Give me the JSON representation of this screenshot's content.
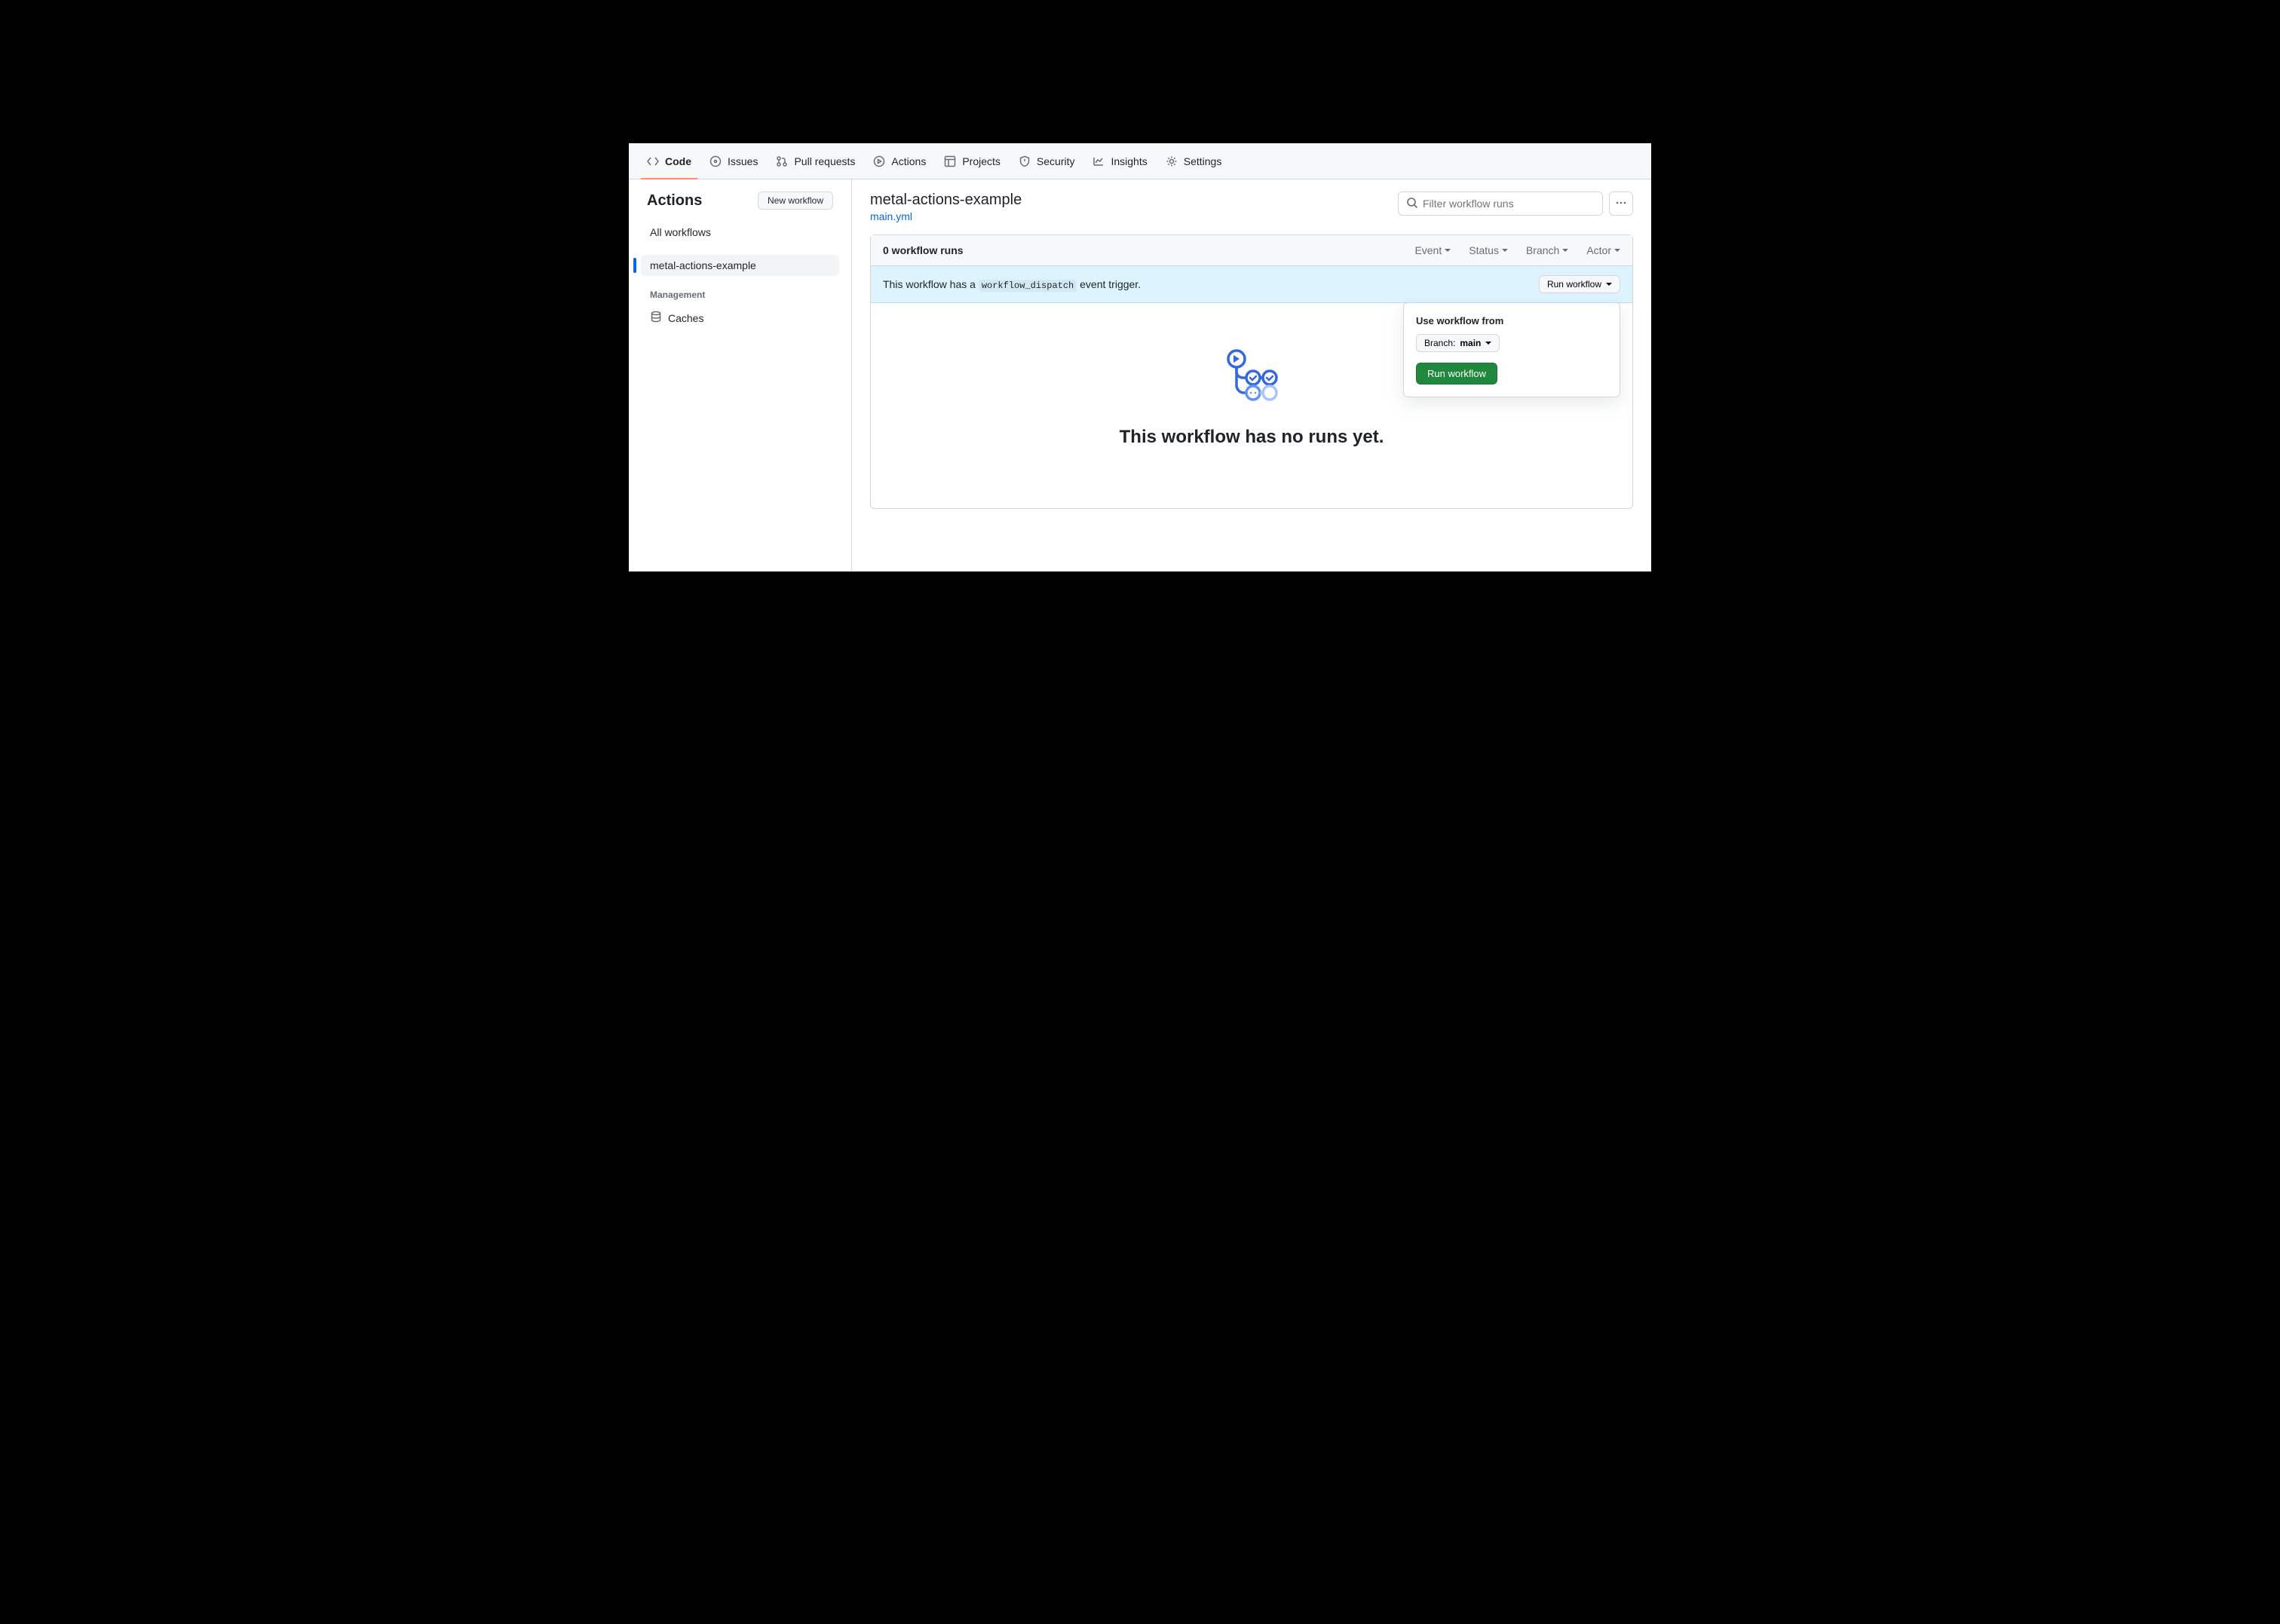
{
  "repo_nav": {
    "items": [
      {
        "label": "Code",
        "selected": true
      },
      {
        "label": "Issues"
      },
      {
        "label": "Pull requests"
      },
      {
        "label": "Actions"
      },
      {
        "label": "Projects"
      },
      {
        "label": "Security"
      },
      {
        "label": "Insights"
      },
      {
        "label": "Settings"
      }
    ]
  },
  "sidebar": {
    "title": "Actions",
    "new_workflow_label": "New workflow",
    "all_workflows_label": "All workflows",
    "workflows": [
      {
        "label": "metal-actions-example",
        "active": true
      }
    ],
    "management_label": "Management",
    "caches_label": "Caches"
  },
  "main": {
    "workflow_title": "metal-actions-example",
    "workflow_file": "main.yml",
    "search_placeholder": "Filter workflow runs",
    "panel": {
      "runs_count_label": "0 workflow runs",
      "filters": {
        "event": "Event",
        "status": "Status",
        "branch": "Branch",
        "actor": "Actor"
      }
    },
    "dispatch": {
      "prefix": "This workflow has a ",
      "code": "workflow_dispatch",
      "suffix": " event trigger.",
      "run_button_label": "Run workflow"
    },
    "popover": {
      "title": "Use workflow from",
      "branch_prefix": "Branch: ",
      "branch_name": "main",
      "submit_label": "Run workflow"
    },
    "empty": {
      "title": "This workflow has no runs yet."
    }
  }
}
